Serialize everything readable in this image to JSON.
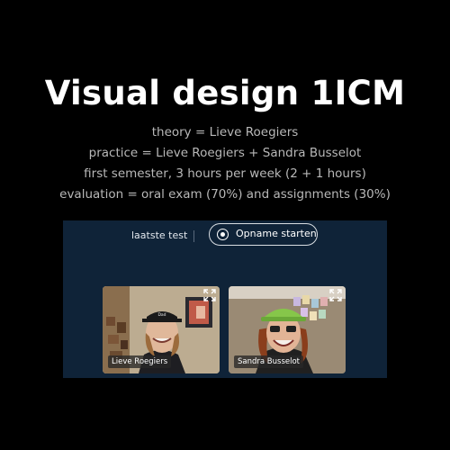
{
  "slide": {
    "title": "Visual design 1ICM",
    "lines": [
      "theory = Lieve Roegiers",
      "practice = Lieve Roegiers + Sandra Busselot",
      "first semester, 3 hours per week (2 + 1 hours)",
      "evaluation = oral exam (70%) and assignments (30%)"
    ]
  },
  "call": {
    "test_label": "laatste test",
    "record_button": {
      "label": "Opname starten",
      "icon": "record-icon"
    },
    "participants": [
      {
        "name": "Lieve Roegiers",
        "expand_icon": "expand-icon"
      },
      {
        "name": "Sandra Busselot",
        "expand_icon": "expand-icon"
      }
    ]
  },
  "colors": {
    "background": "#000000",
    "title": "#ffffff",
    "body_text": "#b8b8b8",
    "call_panel": "#0f2338"
  }
}
